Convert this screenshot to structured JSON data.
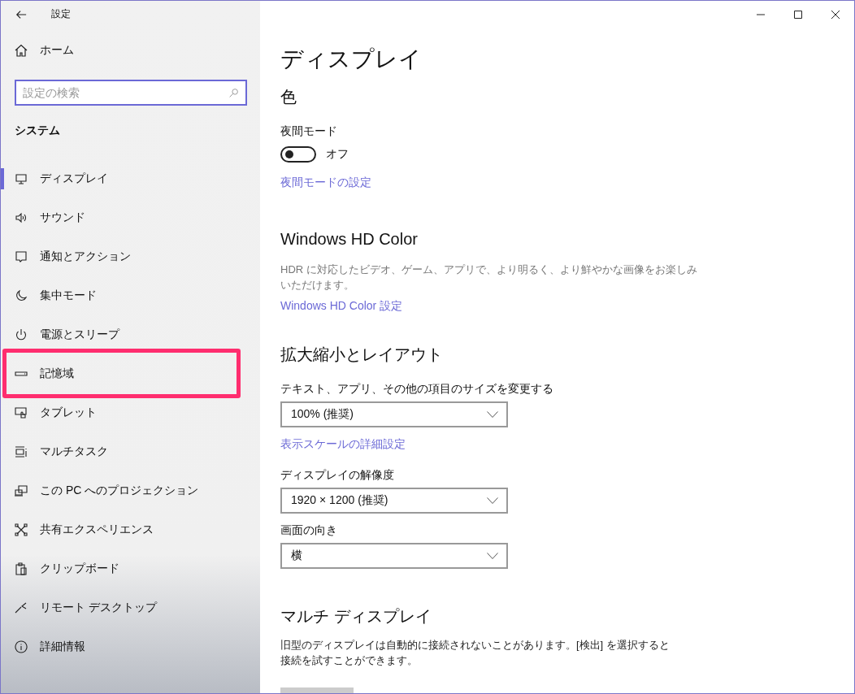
{
  "window": {
    "title": "設定"
  },
  "sidebar": {
    "home": "ホーム",
    "search": {
      "placeholder": "設定の検索"
    },
    "section": "システム",
    "items": [
      {
        "label": "ディスプレイ",
        "selected": true,
        "highlighted": false
      },
      {
        "label": "サウンド",
        "selected": false,
        "highlighted": false
      },
      {
        "label": "通知とアクション",
        "selected": false,
        "highlighted": false
      },
      {
        "label": "集中モード",
        "selected": false,
        "highlighted": false
      },
      {
        "label": "電源とスリープ",
        "selected": false,
        "highlighted": false
      },
      {
        "label": "記憶域",
        "selected": false,
        "highlighted": true
      },
      {
        "label": "タブレット",
        "selected": false,
        "highlighted": false
      },
      {
        "label": "マルチタスク",
        "selected": false,
        "highlighted": false
      },
      {
        "label": "この PC へのプロジェクション",
        "selected": false,
        "highlighted": false
      },
      {
        "label": "共有エクスペリエンス",
        "selected": false,
        "highlighted": false
      },
      {
        "label": "クリップボード",
        "selected": false,
        "highlighted": false
      },
      {
        "label": "リモート デスクトップ",
        "selected": false,
        "highlighted": false
      },
      {
        "label": "詳細情報",
        "selected": false,
        "highlighted": false
      }
    ]
  },
  "page": {
    "title": "ディスプレイ",
    "color": {
      "heading": "色",
      "night_label": "夜間モード",
      "toggle": {
        "on": false,
        "state": "オフ"
      },
      "link": "夜間モードの設定"
    },
    "hd_color": {
      "heading": "Windows HD Color",
      "description": "HDR に対応したビデオ、ゲーム、アプリで、より明るく、より鮮やかな画像をお楽しみいただけます。",
      "link": "Windows HD Color 設定"
    },
    "layout": {
      "heading": "拡大縮小とレイアウト",
      "size_label": "テキスト、アプリ、その他の項目のサイズを変更する",
      "size_value": "100% (推奨)",
      "link": "表示スケールの詳細設定",
      "resolution_label": "ディスプレイの解像度",
      "resolution_value": "1920 × 1200 (推奨)",
      "orientation_label": "画面の向き",
      "orientation_value": "横"
    },
    "multi": {
      "heading": "マルチ ディスプレイ",
      "description": "旧型のディスプレイは自動的に接続されないことがあります。[検出] を選択すると接続を試すことができます。"
    }
  }
}
